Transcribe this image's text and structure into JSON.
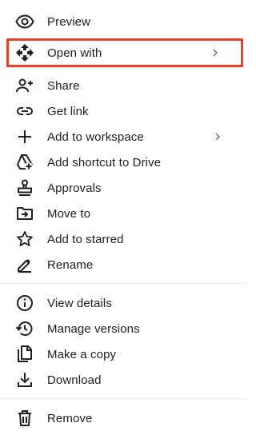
{
  "colors": {
    "text": "#202124",
    "icon": "#202124",
    "chevron": "#5f6368",
    "highlight_border": "#e8412c",
    "divider": "#e8eaed"
  },
  "menu": {
    "group1": [
      {
        "label": "Preview",
        "icon": "eye-icon"
      },
      {
        "label": "Open with",
        "icon": "move-arrows-icon",
        "submenu": true,
        "highlighted": true
      }
    ],
    "group2": [
      {
        "label": "Share",
        "icon": "person-add-icon"
      },
      {
        "label": "Get link",
        "icon": "link-icon"
      },
      {
        "label": "Add to workspace",
        "icon": "plus-icon",
        "submenu": true
      },
      {
        "label": "Add shortcut to Drive",
        "icon": "drive-shortcut-icon"
      },
      {
        "label": "Approvals",
        "icon": "stamp-icon"
      },
      {
        "label": "Move to",
        "icon": "folder-move-icon"
      },
      {
        "label": "Add to starred",
        "icon": "star-icon"
      },
      {
        "label": "Rename",
        "icon": "pencil-icon"
      }
    ],
    "group3": [
      {
        "label": "View details",
        "icon": "info-icon"
      },
      {
        "label": "Manage versions",
        "icon": "history-icon"
      },
      {
        "label": "Make a copy",
        "icon": "copy-icon"
      },
      {
        "label": "Download",
        "icon": "download-icon"
      }
    ],
    "group4": [
      {
        "label": "Remove",
        "icon": "trash-icon"
      }
    ]
  }
}
